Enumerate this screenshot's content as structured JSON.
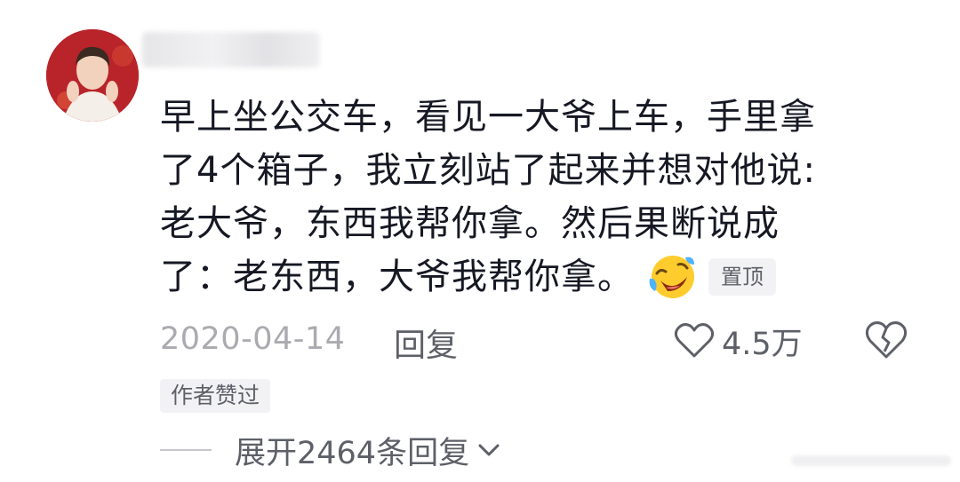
{
  "comment": {
    "lines": [
      "早上坐公交车，看见一大爷上车，手里拿",
      "了4个箱子，我立刻站了起来并想对他说:",
      "老大爷，东西我帮你拿。然后果断说成",
      "了：老东西，大爷我帮你拿。"
    ],
    "emoji": "laughing-crying-emoji",
    "pinned_label": "置顶"
  },
  "meta": {
    "date": "2020-04-14",
    "reply_label": "回复",
    "like_count": "4.5万"
  },
  "author_liked_label": "作者赞过",
  "expand_replies_label": "展开2464条回复",
  "colors": {
    "text_primary": "#161823",
    "text_secondary": "#5e6068",
    "text_muted": "#aaaab0",
    "badge_bg": "#f2f2f4"
  }
}
